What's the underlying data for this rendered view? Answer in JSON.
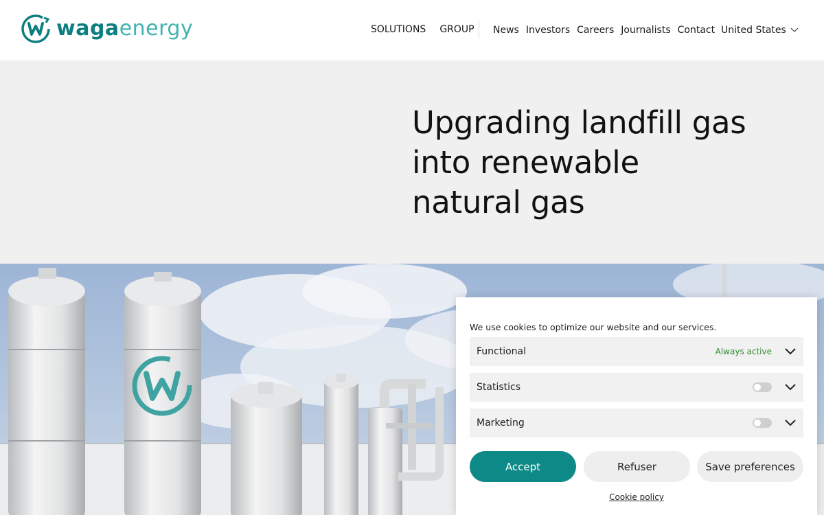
{
  "header": {
    "logo_part1": "waga",
    "logo_part2": "energy",
    "nav_main": [
      "SOLUTIONS",
      "GROUP"
    ],
    "nav_secondary": [
      "News",
      "Investors",
      "Careers",
      "Journalists",
      "Contact"
    ],
    "country": "United States"
  },
  "hero": {
    "title_lines": [
      "Upgrading landfill gas",
      "into renewable",
      "natural gas"
    ]
  },
  "cookie": {
    "message": "We use cookies to optimize our website and our services.",
    "categories": [
      {
        "label": "Functional",
        "status": "Always active"
      },
      {
        "label": "Statistics",
        "enabled": false
      },
      {
        "label": "Marketing",
        "enabled": false
      }
    ],
    "accept_label": "Accept",
    "refuse_label": "Refuser",
    "save_label": "Save preferences",
    "policy_label": "Cookie policy"
  },
  "colors": {
    "brand_dark": "#0d7f80",
    "brand_light": "#3fb2b1",
    "accept_button": "#0d8a88",
    "always_active": "#2b8a2b"
  }
}
